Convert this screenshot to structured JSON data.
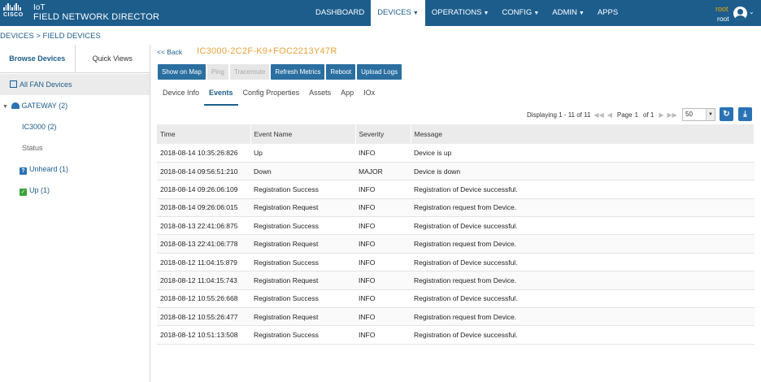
{
  "header": {
    "brand": "CISCO",
    "app_prefix": "IoT",
    "app_name": "FIELD NETWORK DIRECTOR",
    "nav": [
      {
        "label": "DASHBOARD",
        "has_caret": false
      },
      {
        "label": "DEVICES",
        "has_caret": true,
        "active": true
      },
      {
        "label": "OPERATIONS",
        "has_caret": true
      },
      {
        "label": "CONFIG",
        "has_caret": true
      },
      {
        "label": "ADMIN",
        "has_caret": true
      },
      {
        "label": "APPS",
        "has_caret": false
      }
    ],
    "user_role": "root",
    "user_name": "root"
  },
  "breadcrumb": "DEVICES > FIELD DEVICES",
  "left_panel": {
    "tabs": [
      "Browse Devices",
      "Quick Views"
    ],
    "all_fan_devices": "All FAN Devices",
    "gateway": "GATEWAY (2)",
    "ic3000": "IC3000 (2)",
    "status": "Status",
    "unheard": "Unheard (1)",
    "up": "Up (1)"
  },
  "main": {
    "back": "<< Back",
    "device_title": "IC3000-2C2F-K9+FOC2213Y47R",
    "buttons": [
      "Show on Map",
      "Ping",
      "Traceroute",
      "Refresh Metrics",
      "Reboot",
      "Upload Logs"
    ],
    "tabs": [
      "Device Info",
      "Events",
      "Config Properties",
      "Assets",
      "App",
      "IOx"
    ],
    "pager": {
      "displaying": "Displaying 1 - 11 of 11",
      "page_label": "Page",
      "page": "1",
      "of_label": "of 1",
      "page_size": "50"
    },
    "columns": [
      "Time",
      "Event Name",
      "Severity",
      "Message"
    ],
    "rows": [
      [
        "2018-08-14 10:35:26:826",
        "Up",
        "INFO",
        "Device is up"
      ],
      [
        "2018-08-14 09:56:51:210",
        "Down",
        "MAJOR",
        "Device is down"
      ],
      [
        "2018-08-14 09:26:06:109",
        "Registration Success",
        "INFO",
        "Registration of Device successful."
      ],
      [
        "2018-08-14 09:26:06:015",
        "Registration Request",
        "INFO",
        "Registration request from Device."
      ],
      [
        "2018-08-13 22:41:06:875",
        "Registration Success",
        "INFO",
        "Registration of Device successful."
      ],
      [
        "2018-08-13 22:41:06:778",
        "Registration Request",
        "INFO",
        "Registration request from Device."
      ],
      [
        "2018-08-12 11:04:15:879",
        "Registration Success",
        "INFO",
        "Registration of Device successful."
      ],
      [
        "2018-08-12 11:04:15:743",
        "Registration Request",
        "INFO",
        "Registration request from Device."
      ],
      [
        "2018-08-12 10:55:26:668",
        "Registration Success",
        "INFO",
        "Registration of Device successful."
      ],
      [
        "2018-08-12 10:55:26:477",
        "Registration Request",
        "INFO",
        "Registration request from Device."
      ],
      [
        "2018-08-12 10:51:13:508",
        "Registration Success",
        "INFO",
        "Registration of Device successful."
      ]
    ]
  },
  "colors": {
    "header_bg": "#1c5d8c",
    "accent_orange": "#e8a23a",
    "button_blue": "#2a6f9f"
  }
}
